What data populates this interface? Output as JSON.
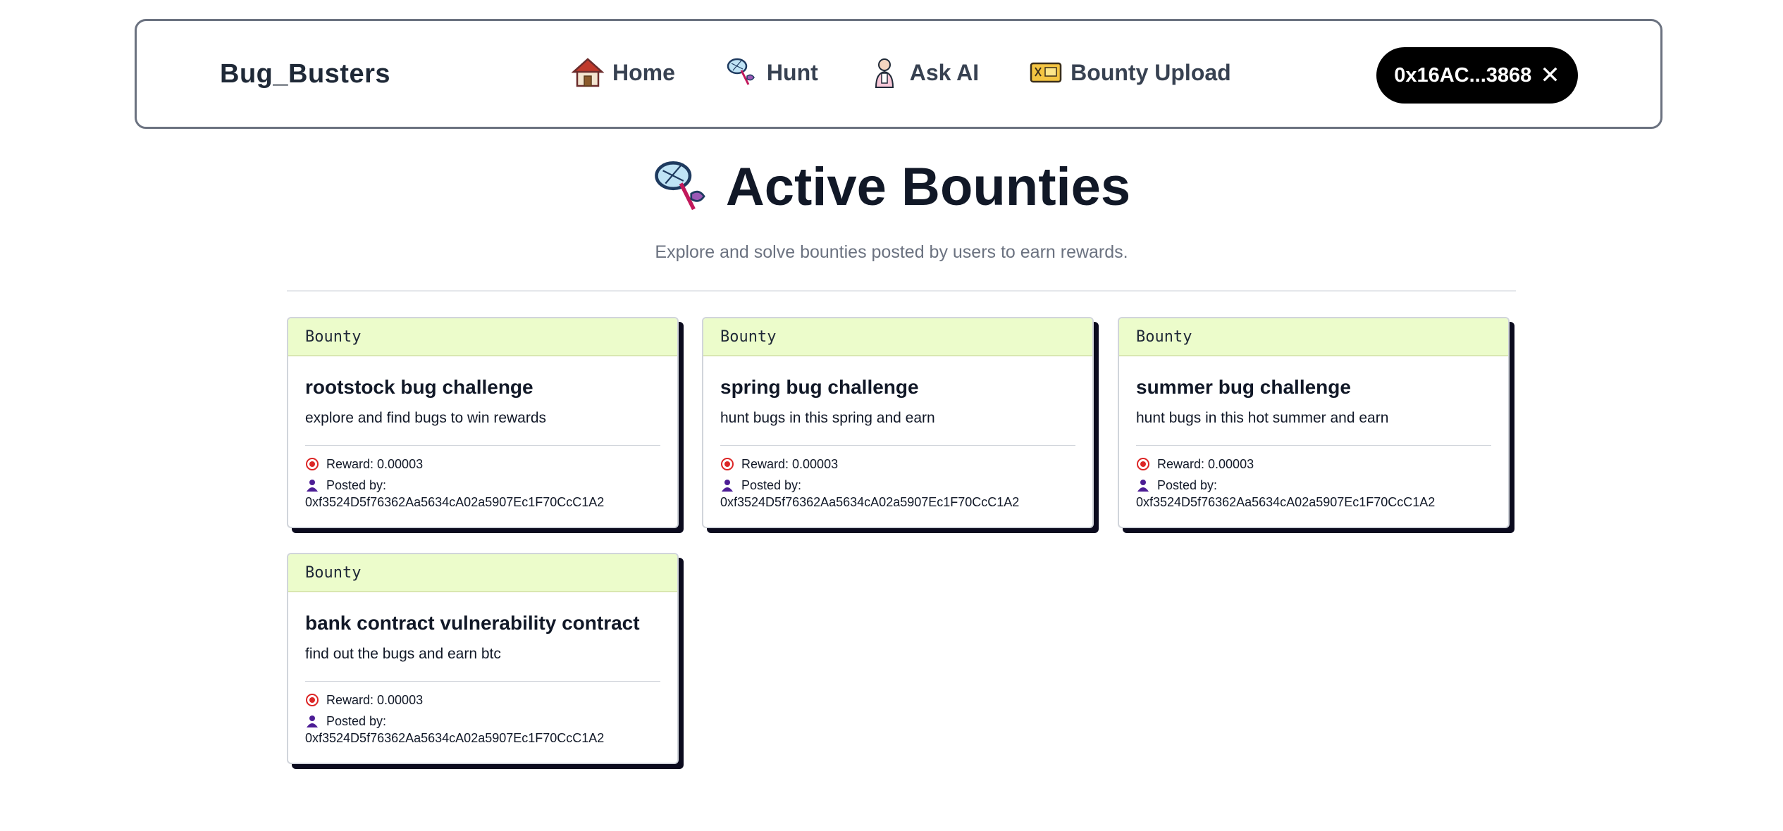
{
  "navbar": {
    "brand": "Bug_Busters",
    "links": [
      {
        "label": "Home",
        "icon": "house-icon"
      },
      {
        "label": "Hunt",
        "icon": "bug-net-icon"
      },
      {
        "label": "Ask AI",
        "icon": "person-icon"
      },
      {
        "label": "Bounty Upload",
        "icon": "ticket-icon"
      }
    ],
    "wallet": {
      "address": "0x16AC...3868",
      "close": "✕"
    }
  },
  "header": {
    "title": "Active Bounties",
    "subtitle": "Explore and solve bounties posted by users to earn rewards."
  },
  "bounties": [
    {
      "tag": "Bounty",
      "title": "rootstock bug challenge",
      "description": "explore and find bugs to win rewards",
      "reward": "Reward: 0.00003",
      "posted_label": "Posted by:",
      "poster": "0xf3524D5f76362Aa5634cA02a5907Ec1F70CcC1A2"
    },
    {
      "tag": "Bounty",
      "title": "spring bug challenge",
      "description": "hunt bugs in this spring and earn",
      "reward": "Reward: 0.00003",
      "posted_label": "Posted by:",
      "poster": "0xf3524D5f76362Aa5634cA02a5907Ec1F70CcC1A2"
    },
    {
      "tag": "Bounty",
      "title": "summer bug challenge",
      "description": "hunt bugs in this hot summer and earn",
      "reward": "Reward: 0.00003",
      "posted_label": "Posted by:",
      "poster": "0xf3524D5f76362Aa5634cA02a5907Ec1F70CcC1A2"
    },
    {
      "tag": "Bounty",
      "title": "bank contract vulnerability contract",
      "description": "find out the bugs and earn btc",
      "reward": "Reward: 0.00003",
      "posted_label": "Posted by:",
      "poster": "0xf3524D5f76362Aa5634cA02a5907Ec1F70CcC1A2"
    }
  ]
}
